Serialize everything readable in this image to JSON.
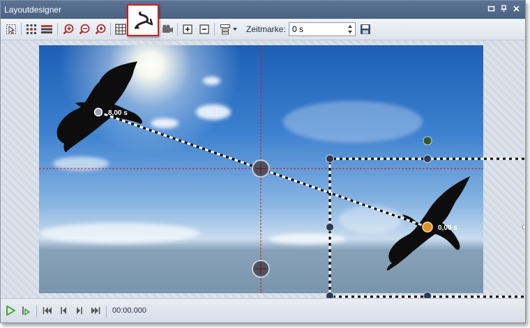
{
  "window": {
    "title": "Layoutdesigner"
  },
  "toolbar": {
    "zeitmarke_label": "Zeitmarke:",
    "zeitmarke_value": "0 s"
  },
  "path": {
    "start_label": "8,00 s",
    "end_label": "0,00 s"
  },
  "playback": {
    "timecode": "00:00.000"
  },
  "colors": {
    "titlebar": "#4b6283",
    "highlight_border": "#d21c1c",
    "guide_line": "#d01818",
    "end_point": "#e0902c",
    "rotation_handle": "#2f5a2c"
  }
}
